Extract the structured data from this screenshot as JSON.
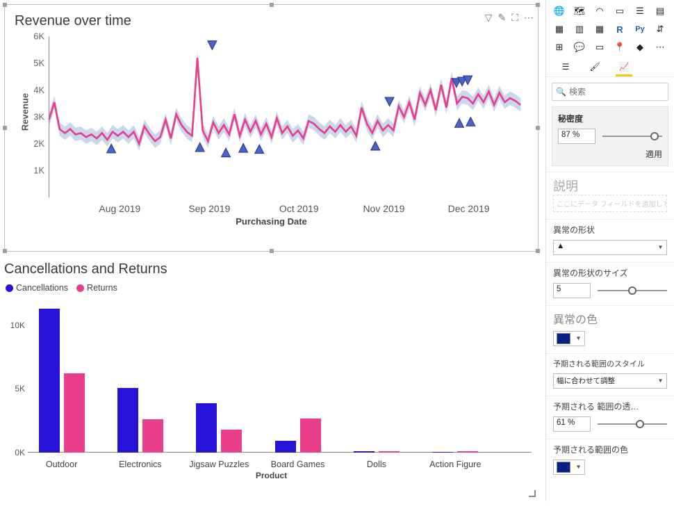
{
  "chart_data": [
    {
      "type": "line",
      "title": "Revenue over time",
      "xlabel": "Purchasing Date",
      "ylabel": "Revenue",
      "ylim": [
        0,
        6000
      ],
      "yticks": [
        "1K",
        "2K",
        "3K",
        "4K",
        "5K",
        "6K"
      ],
      "xticks": [
        "Aug 2019",
        "Sep 2019",
        "Oct 2019",
        "Nov 2019",
        "Dec 2019"
      ],
      "anomaly_markers_high": [
        {
          "x": 0.346,
          "y": 5450
        },
        {
          "x": 0.722,
          "y": 3350
        },
        {
          "x": 0.864,
          "y": 4050
        },
        {
          "x": 0.876,
          "y": 4100
        },
        {
          "x": 0.888,
          "y": 4150
        }
      ],
      "anomaly_markers_low": [
        {
          "x": 0.132,
          "y": 2100
        },
        {
          "x": 0.32,
          "y": 2150
        },
        {
          "x": 0.375,
          "y": 1950
        },
        {
          "x": 0.412,
          "y": 2120
        },
        {
          "x": 0.446,
          "y": 2080
        },
        {
          "x": 0.692,
          "y": 2200
        },
        {
          "x": 0.87,
          "y": 3050
        },
        {
          "x": 0.894,
          "y": 3100
        }
      ],
      "series": [
        {
          "name": "Revenue",
          "color": "#e83e8c",
          "values": [
            2900,
            3550,
            2550,
            2400,
            2550,
            2350,
            2400,
            2250,
            2350,
            2200,
            2400,
            2150,
            2450,
            2300,
            2450,
            2250,
            2450,
            2000,
            2650,
            2350,
            2100,
            2250,
            2900,
            2200,
            3100,
            2700,
            2450,
            2300,
            5200,
            2500,
            2100,
            2800,
            2400,
            2700,
            2350,
            3100,
            2300,
            2900,
            2450,
            2850,
            2350,
            2750,
            2250,
            2950,
            2400,
            2650,
            2300,
            2500,
            2200,
            2850,
            2750,
            2550,
            2400,
            2650,
            2450,
            2700,
            2450,
            2650,
            2300,
            3350,
            2750,
            2400,
            2850,
            2500,
            2700,
            2500,
            3400,
            3000,
            3550,
            2900,
            3900,
            3450,
            4000,
            3250,
            4200,
            3350,
            4450,
            3500,
            3750,
            3700,
            3500,
            3850,
            3550,
            3950,
            3450,
            3900,
            3550,
            3700,
            3600,
            3450
          ]
        }
      ]
    },
    {
      "type": "bar",
      "title": "Cancellations and Returns",
      "xlabel": "Product",
      "ylabel": "",
      "ylim": [
        0,
        12000
      ],
      "yticks": [
        "0K",
        "5K",
        "10K"
      ],
      "categories": [
        "Outdoor",
        "Electronics",
        "Jigsaw Puzzles",
        "Board Games",
        "Dolls",
        "Action Figure"
      ],
      "series": [
        {
          "name": "Cancellations",
          "color": "#2713d8",
          "values": [
            11300,
            5100,
            3900,
            950,
            120,
            80
          ]
        },
        {
          "name": "Returns",
          "color": "#e83e8c",
          "values": [
            6200,
            2600,
            1800,
            2650,
            130,
            100
          ]
        }
      ]
    }
  ],
  "line": {
    "title": "Revenue over time",
    "xlabel": "Purchasing Date",
    "ylabel": "Revenue"
  },
  "bar": {
    "title": "Cancellations and Returns",
    "xlabel": "Product",
    "legend": {
      "a": "Cancellations",
      "b": "Returns"
    }
  },
  "sidebar": {
    "tab_icons": {
      "fields": "☰",
      "format": "🖌",
      "analytics": "📈"
    },
    "search_placeholder": "検索",
    "sensitivity": {
      "title": "秘密度",
      "value": "87  %",
      "apply": "適用"
    },
    "explain": {
      "title": "説明",
      "placeholder": "ここにデータ フィールドを追加してください"
    },
    "anomaly_shape": {
      "title": "異常の形状",
      "value": "▲"
    },
    "anomaly_size": {
      "title": "異常の形状のサイズ",
      "value": "5"
    },
    "anomaly_color": {
      "title": "異常の色",
      "value": "#0a1e8a"
    },
    "range_style": {
      "title": "予期される範囲のスタイル",
      "value": "幅に合わせて調整"
    },
    "range_opacity": {
      "title": "予期される 範囲の透…",
      "value": "61  %"
    },
    "range_color": {
      "title": "予期される範囲の色",
      "value": "#0a1e8a"
    }
  }
}
